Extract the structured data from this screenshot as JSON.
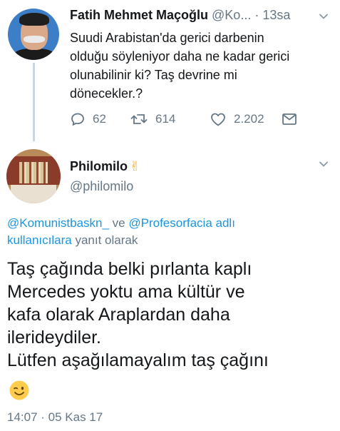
{
  "parent_tweet": {
    "name": "Fatih Mehmet Maçoğlu",
    "handle": "@Ko...",
    "separator": "·",
    "time": "13sa",
    "lines": [
      "Suudi Arabistan'da gerici darbenin",
      "olduğu söyleniyor daha ne kadar gerici",
      "olunabilinir ki? Taş devrine mi",
      "dönecekler.?"
    ],
    "reply_count": "62",
    "retweet_count": "614",
    "like_count": "2.202"
  },
  "main_tweet": {
    "name": "Philomilo",
    "name_emoji": "✌",
    "handle": "@philomilo",
    "reply_to": {
      "mention_1": "@Komunistbaskn_",
      "connector": " ve ",
      "mention_2": "@Profesorfacia",
      "suffix_1": " adlı",
      "mention_3": "kullanıcılara",
      "suffix_2": " yanıt olarak"
    },
    "lines": [
      "Taş çağında belki pırlanta kaplı",
      "Mercedes yoktu ama kültür ve",
      "kafa olarak Araplardan daha",
      "ilerideydiler.",
      "Lütfen aşağılamayalım taş çağını"
    ],
    "timestamp": "14:07 · 05 Kas 17"
  },
  "colors": {
    "text": "#14171a",
    "secondary": "#657786",
    "link": "#1b95e0",
    "thread_line": "#ccd6dd"
  },
  "icons": [
    "chevron-down-icon",
    "reply-icon",
    "retweet-icon",
    "like-icon",
    "direct-message-icon",
    "wink-emoji-icon"
  ]
}
